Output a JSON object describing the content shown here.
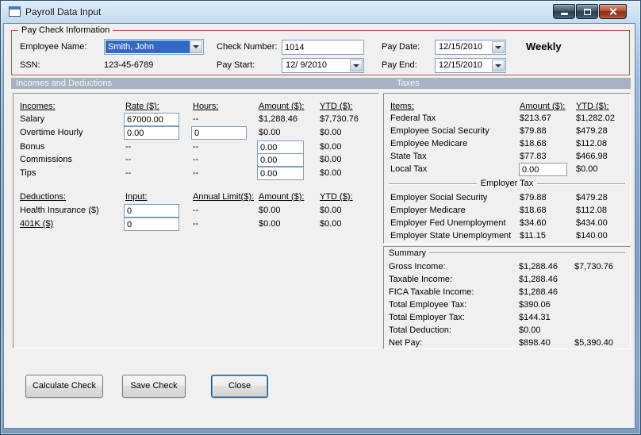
{
  "window": {
    "title": "Payroll Data Input"
  },
  "section_bar": {
    "left_title": "Incomes and Deductions",
    "right_title": "Taxes"
  },
  "paycheck": {
    "group_title": "Pay Check Information",
    "employee_name_label": "Employee Name:",
    "employee_name_value": "Smith, John",
    "ssn_label": "SSN:",
    "ssn_value": "123-45-6789",
    "check_number_label": "Check Number:",
    "check_number_value": "1014",
    "pay_start_label": "Pay Start:",
    "pay_start_value": "12/ 9/2010",
    "pay_date_label": "Pay Date:",
    "pay_date_value": "12/15/2010",
    "pay_end_label": "Pay End:",
    "pay_end_value": "12/15/2010",
    "frequency": "Weekly"
  },
  "incomes": {
    "headers": {
      "name": "Incomes:",
      "rate": "Rate ($):",
      "hours": "Hours:",
      "amount": "Amount ($):",
      "ytd": "YTD ($):"
    },
    "rows": [
      {
        "label": "Salary",
        "rate": "67000.00",
        "hours": "--",
        "amount": "$1,288.46",
        "ytd": "$7,730.76"
      },
      {
        "label": "Overtime Hourly",
        "rate": "0.00",
        "hours": "0",
        "amount": "$0.00",
        "ytd": "$0.00"
      },
      {
        "label": "Bonus",
        "rate": "--",
        "hours": "--",
        "amount": "0.00",
        "ytd": "$0.00"
      },
      {
        "label": "Commissions",
        "rate": "--",
        "hours": "--",
        "amount": "0.00",
        "ytd": "$0.00"
      },
      {
        "label": "Tips",
        "rate": "--",
        "hours": "--",
        "amount": "0.00",
        "ytd": "$0.00"
      }
    ]
  },
  "deductions": {
    "headers": {
      "name": "Deductions:",
      "input": "Input:",
      "limit": "Annual Limit($):",
      "amount": "Amount ($):",
      "ytd": "YTD ($):"
    },
    "rows": [
      {
        "label": "Health Insurance ($)",
        "input": "0",
        "limit": "--",
        "amount": "$0.00",
        "ytd": "$0.00"
      },
      {
        "label": "401K ($)",
        "input": "0",
        "limit": "--",
        "amount": "$0.00",
        "ytd": "$0.00"
      }
    ]
  },
  "taxes": {
    "headers": {
      "items": "Items:",
      "amount": "Amount ($):",
      "ytd": "YTD ($):"
    },
    "employee_rows": [
      {
        "label": "Federal Tax",
        "amount": "$213.67",
        "ytd": "$1,282.02"
      },
      {
        "label": "Employee Social Security",
        "amount": "$79.88",
        "ytd": "$479.28"
      },
      {
        "label": "Employee Medicare",
        "amount": "$18.68",
        "ytd": "$112.08"
      },
      {
        "label": "State Tax",
        "amount": "$77.83",
        "ytd": "$466.98"
      },
      {
        "label": "Local Tax",
        "amount": "0.00",
        "ytd": "$0.00"
      }
    ],
    "employer_section_title": "Employer Tax",
    "employer_rows": [
      {
        "label": "Employer Social Security",
        "amount": "$79.88",
        "ytd": "$479.28"
      },
      {
        "label": "Employer Medicare",
        "amount": "$18.68",
        "ytd": "$112.08"
      },
      {
        "label": "Employer Fed Unemployment",
        "amount": "$34.60",
        "ytd": "$434.00"
      },
      {
        "label": "Employer State Unemployment",
        "amount": "$11.15",
        "ytd": "$140.00"
      }
    ]
  },
  "summary": {
    "title": "Summary",
    "rows": [
      {
        "label": "Gross Income:",
        "amount": "$1,288.46",
        "ytd": "$7,730.76"
      },
      {
        "label": "Taxable Income:",
        "amount": "$1,288.46",
        "ytd": ""
      },
      {
        "label": "FICA Taxable Income:",
        "amount": "$1,288.46",
        "ytd": ""
      },
      {
        "label": "Total Employee Tax:",
        "amount": "$390.06",
        "ytd": ""
      },
      {
        "label": "Total Employer Tax:",
        "amount": "$144.31",
        "ytd": ""
      },
      {
        "label": "Total Deduction:",
        "amount": "$0.00",
        "ytd": ""
      },
      {
        "label": "Net Pay:",
        "amount": "$898.40",
        "ytd": "$5,390.40"
      }
    ]
  },
  "buttons": {
    "calculate": "Calculate Check",
    "save": "Save Check",
    "close": "Close"
  }
}
